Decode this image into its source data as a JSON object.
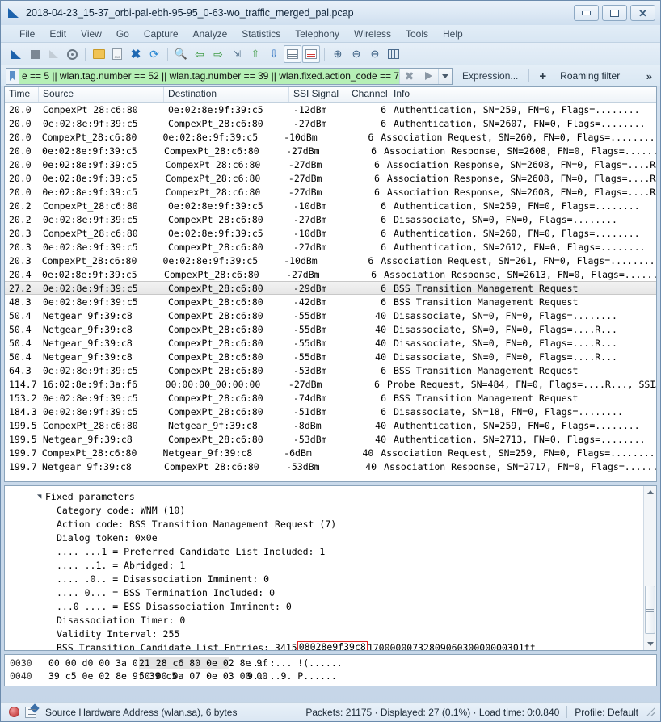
{
  "window": {
    "title": "2018-04-23_15-37_orbi-pal-ebh-95-95_0-63-wo_traffic_merged_pal.pcap",
    "minimize_label": "",
    "maximize_label": "",
    "close_label": "✕"
  },
  "menu": {
    "items": [
      {
        "label": "File"
      },
      {
        "label": "Edit"
      },
      {
        "label": "View"
      },
      {
        "label": "Go"
      },
      {
        "label": "Capture"
      },
      {
        "label": "Analyze"
      },
      {
        "label": "Statistics"
      },
      {
        "label": "Telephony"
      },
      {
        "label": "Wireless"
      },
      {
        "label": "Tools"
      },
      {
        "label": "Help"
      }
    ]
  },
  "toolbar": {
    "icons": [
      "start-capture-icon",
      "stop-capture-icon",
      "restart-capture-icon",
      "capture-options-icon",
      "open-file-icon",
      "save-file-icon",
      "close-file-icon",
      "reload-file-icon",
      "find-packet-icon",
      "go-back-icon",
      "go-forward-icon",
      "go-to-packet-icon",
      "go-first-packet-icon",
      "go-last-packet-icon",
      "autoscroll-icon",
      "colorize-icon",
      "zoom-in-icon",
      "zoom-out-icon",
      "zoom-reset-icon",
      "resize-columns-icon"
    ]
  },
  "filter": {
    "value": "e == 5 || wlan.tag.number == 52 || wlan.tag.number == 39 || wlan.fixed.action_code == 7",
    "expression_label": "Expression...",
    "plus_label": "+",
    "saved_filter_label": "Roaming filter",
    "overflow_label": "»"
  },
  "packet_list": {
    "columns": [
      "Time",
      "Source",
      "Destination",
      "SSI Signal",
      "Channel",
      "Info"
    ],
    "selected_index": 13,
    "rows": [
      {
        "time": "20.0",
        "src": "CompexPt_28:c6:80",
        "dst": "0e:02:8e:9f:39:c5",
        "ssi": "-12dBm",
        "chan": "6",
        "info": "Authentication, SN=259, FN=0, Flags=........"
      },
      {
        "time": "20.0",
        "src": "0e:02:8e:9f:39:c5",
        "dst": "CompexPt_28:c6:80",
        "ssi": "-27dBm",
        "chan": "6",
        "info": "Authentication, SN=2607, FN=0, Flags=........"
      },
      {
        "time": "20.0",
        "src": "CompexPt_28:c6:80",
        "dst": "0e:02:8e:9f:39:c5",
        "ssi": "-10dBm",
        "chan": "6",
        "info": "Association Request, SN=260, FN=0, Flags=.........…"
      },
      {
        "time": "20.0",
        "src": "0e:02:8e:9f:39:c5",
        "dst": "CompexPt_28:c6:80",
        "ssi": "-27dBm",
        "chan": "6",
        "info": "Association Response, SN=2608, FN=0, Flags=......…"
      },
      {
        "time": "20.0",
        "src": "0e:02:8e:9f:39:c5",
        "dst": "CompexPt_28:c6:80",
        "ssi": "-27dBm",
        "chan": "6",
        "info": "Association Response, SN=2608, FN=0, Flags=....R…"
      },
      {
        "time": "20.0",
        "src": "0e:02:8e:9f:39:c5",
        "dst": "CompexPt_28:c6:80",
        "ssi": "-27dBm",
        "chan": "6",
        "info": "Association Response, SN=2608, FN=0, Flags=....R…"
      },
      {
        "time": "20.0",
        "src": "0e:02:8e:9f:39:c5",
        "dst": "CompexPt_28:c6:80",
        "ssi": "-27dBm",
        "chan": "6",
        "info": "Association Response, SN=2608, FN=0, Flags=....R…"
      },
      {
        "time": "20.2",
        "src": "CompexPt_28:c6:80",
        "dst": "0e:02:8e:9f:39:c5",
        "ssi": "-10dBm",
        "chan": "6",
        "info": "Authentication, SN=259, FN=0, Flags=........"
      },
      {
        "time": "20.2",
        "src": "0e:02:8e:9f:39:c5",
        "dst": "CompexPt_28:c6:80",
        "ssi": "-27dBm",
        "chan": "6",
        "info": "Disassociate, SN=0, FN=0, Flags=........"
      },
      {
        "time": "20.3",
        "src": "CompexPt_28:c6:80",
        "dst": "0e:02:8e:9f:39:c5",
        "ssi": "-10dBm",
        "chan": "6",
        "info": "Authentication, SN=260, FN=0, Flags=........"
      },
      {
        "time": "20.3",
        "src": "0e:02:8e:9f:39:c5",
        "dst": "CompexPt_28:c6:80",
        "ssi": "-27dBm",
        "chan": "6",
        "info": "Authentication, SN=2612, FN=0, Flags=........"
      },
      {
        "time": "20.3",
        "src": "CompexPt_28:c6:80",
        "dst": "0e:02:8e:9f:39:c5",
        "ssi": "-10dBm",
        "chan": "6",
        "info": "Association Request, SN=261, FN=0, Flags=.........…"
      },
      {
        "time": "20.4",
        "src": "0e:02:8e:9f:39:c5",
        "dst": "CompexPt_28:c6:80",
        "ssi": "-27dBm",
        "chan": "6",
        "info": "Association Response, SN=2613, FN=0, Flags=......…"
      },
      {
        "time": "27.2",
        "src": "0e:02:8e:9f:39:c5",
        "dst": "CompexPt_28:c6:80",
        "ssi": "-29dBm",
        "chan": "6",
        "info": "BSS Transition Management Request"
      },
      {
        "time": "48.3",
        "src": "0e:02:8e:9f:39:c5",
        "dst": "CompexPt_28:c6:80",
        "ssi": "-42dBm",
        "chan": "6",
        "info": "BSS Transition Management Request"
      },
      {
        "time": "50.4",
        "src": "Netgear_9f:39:c8",
        "dst": "CompexPt_28:c6:80",
        "ssi": "-55dBm",
        "chan": "40",
        "info": "Disassociate, SN=0, FN=0, Flags=........"
      },
      {
        "time": "50.4",
        "src": "Netgear_9f:39:c8",
        "dst": "CompexPt_28:c6:80",
        "ssi": "-55dBm",
        "chan": "40",
        "info": "Disassociate, SN=0, FN=0, Flags=....R..."
      },
      {
        "time": "50.4",
        "src": "Netgear_9f:39:c8",
        "dst": "CompexPt_28:c6:80",
        "ssi": "-55dBm",
        "chan": "40",
        "info": "Disassociate, SN=0, FN=0, Flags=....R..."
      },
      {
        "time": "50.4",
        "src": "Netgear_9f:39:c8",
        "dst": "CompexPt_28:c6:80",
        "ssi": "-55dBm",
        "chan": "40",
        "info": "Disassociate, SN=0, FN=0, Flags=....R..."
      },
      {
        "time": "64.3",
        "src": "0e:02:8e:9f:39:c5",
        "dst": "CompexPt_28:c6:80",
        "ssi": "-53dBm",
        "chan": "6",
        "info": "BSS Transition Management Request"
      },
      {
        "time": "114.7",
        "src": "16:02:8e:9f:3a:f6",
        "dst": "00:00:00_00:00:00",
        "ssi": "-27dBm",
        "chan": "6",
        "info": "Probe Request, SN=484, FN=0, Flags=....R..., SSI…"
      },
      {
        "time": "153.2",
        "src": "0e:02:8e:9f:39:c5",
        "dst": "CompexPt_28:c6:80",
        "ssi": "-74dBm",
        "chan": "6",
        "info": "BSS Transition Management Request"
      },
      {
        "time": "184.3",
        "src": "0e:02:8e:9f:39:c5",
        "dst": "CompexPt_28:c6:80",
        "ssi": "-51dBm",
        "chan": "6",
        "info": "Disassociate, SN=18, FN=0, Flags=........"
      },
      {
        "time": "199.5",
        "src": "CompexPt_28:c6:80",
        "dst": "Netgear_9f:39:c8",
        "ssi": "-8dBm",
        "chan": "40",
        "info": "Authentication, SN=259, FN=0, Flags=........"
      },
      {
        "time": "199.5",
        "src": "Netgear_9f:39:c8",
        "dst": "CompexPt_28:c6:80",
        "ssi": "-53dBm",
        "chan": "40",
        "info": "Authentication, SN=2713, FN=0, Flags=........"
      },
      {
        "time": "199.7",
        "src": "CompexPt_28:c6:80",
        "dst": "Netgear_9f:39:c8",
        "ssi": "-6dBm",
        "chan": "40",
        "info": "Association Request, SN=259, FN=0, Flags=.........…"
      },
      {
        "time": "199.7",
        "src": "Netgear_9f:39:c8",
        "dst": "CompexPt_28:c6:80",
        "ssi": "-53dBm",
        "chan": "40",
        "info": "Association Response, SN=2717, FN=0, Flags=......…"
      }
    ]
  },
  "detail": {
    "rows": [
      {
        "indent": 1,
        "twisty": "▲",
        "text": "Fixed parameters"
      },
      {
        "indent": 2,
        "twisty": "",
        "text": "Category code: WNM (10)"
      },
      {
        "indent": 2,
        "twisty": "",
        "text": "Action code: BSS Transition Management Request (7)"
      },
      {
        "indent": 2,
        "twisty": "",
        "text": "Dialog token: 0x0e"
      },
      {
        "indent": 2,
        "twisty": "",
        "text": ".... ...1 = Preferred Candidate List Included: 1"
      },
      {
        "indent": 2,
        "twisty": "",
        "text": ".... ..1. = Abridged: 1"
      },
      {
        "indent": 2,
        "twisty": "",
        "text": ".... .0.. = Disassociation Imminent: 0"
      },
      {
        "indent": 2,
        "twisty": "",
        "text": ".... 0... = BSS Termination Included: 0"
      },
      {
        "indent": 2,
        "twisty": "",
        "text": "...0 .... = ESS Disassociation Imminent: 0"
      },
      {
        "indent": 2,
        "twisty": "",
        "text": "Disassociation Timer: 0"
      },
      {
        "indent": 2,
        "twisty": "",
        "text": "Validity Interval: 255"
      }
    ],
    "candidate_row": {
      "prefix": "BSS Transition Candidate List Entries: 3415",
      "highlight": "08028e9f39c8",
      "suffix": "1700000073280906030000000301ff"
    }
  },
  "hex": {
    "rows": [
      {
        "offset": "0030",
        "bytes_left": "00 00 d0 00 3a 01 04 f0",
        "bytes_right": "21 28 c6 80 0e 02 8e 9f",
        "ascii": "....:... !(......"
      },
      {
        "offset": "0040",
        "bytes_left": "39 c5 0e 02 8e 9f 39 c5",
        "bytes_right": "50 00 0a 07 0e 03 00 00",
        "ascii": "9.....9. P......"
      }
    ]
  },
  "status": {
    "field_text": "Source Hardware Address (wlan.sa), 6 bytes",
    "packets_text": "Packets: 21175 · Displayed: 27 (0.1%) · Load time: 0:0.840",
    "profile_text": "Profile: Default"
  },
  "colors": {
    "filter_valid_bg": "#b6f0b6",
    "highlight_border": "#e02020",
    "accent": "#1d62ac"
  }
}
